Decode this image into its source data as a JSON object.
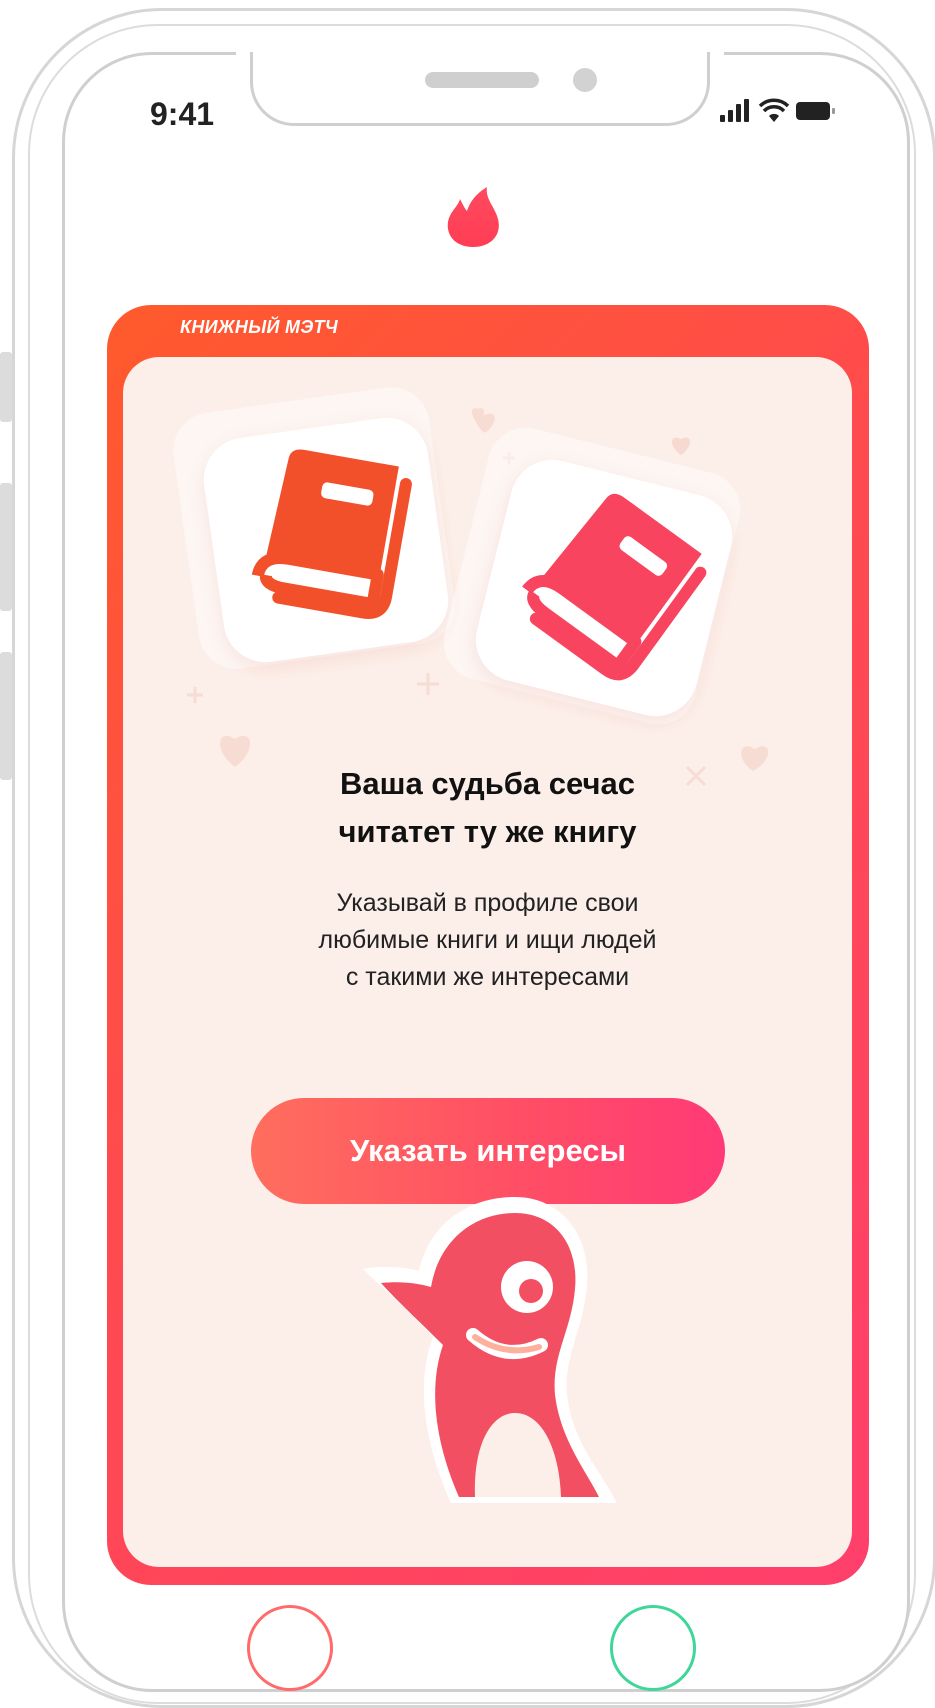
{
  "status_bar": {
    "time": "9:41"
  },
  "card": {
    "label": "КНИЖНЫЙ МЭТЧ",
    "headline": [
      "Ваша судьба сечас",
      "читатет ту же книгу"
    ],
    "description": [
      "Указывай в профиле свои",
      "любимые книги и ищи людей",
      "с такими же интересами"
    ],
    "cta_label": "Указать интересы"
  },
  "icons": {
    "logo": "flame-icon",
    "books": [
      "book-icon",
      "book-icon"
    ],
    "mascot": "penguin-icon",
    "status": [
      "signal-icon",
      "wifi-icon",
      "battery-icon"
    ]
  },
  "colors": {
    "brand_orange": "#ff5a2c",
    "brand_pink": "#ff3f6c",
    "card_background": "#fcefe9",
    "book_orange": "#f2502b",
    "book_pink": "#f8445e"
  }
}
